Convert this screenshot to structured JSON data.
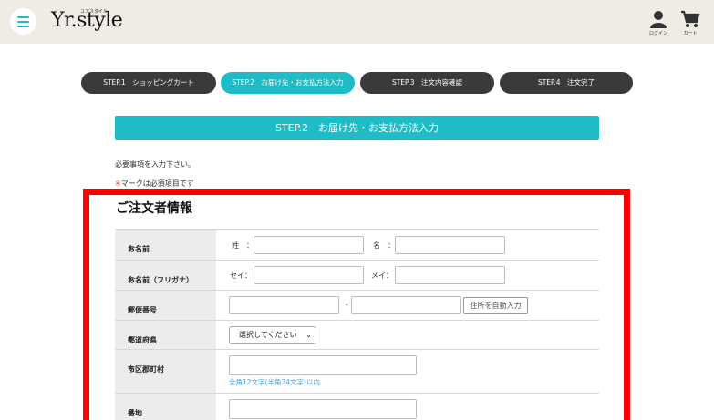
{
  "header": {
    "logo_sub": "ユアスタイル",
    "logo_text": "Yr.style",
    "login_label": "ログイン",
    "cart_label": "カート"
  },
  "steps": [
    {
      "label": "STEP.1　ショッピングカート",
      "active": false
    },
    {
      "label": "STEP.2　お届け先・お支払方法入力",
      "active": true
    },
    {
      "label": "STEP.3　注文内容確認",
      "active": false
    },
    {
      "label": "STEP.4　注文完了",
      "active": false
    }
  ],
  "page_title": "STEP.2　お届け先・お支払方法入力",
  "notes": {
    "required_entry": "必要事項を入力下さい。",
    "required_mark": "※",
    "required_mark_text": "マークは必須項目です"
  },
  "section_title": "ご注文者情報",
  "form": {
    "required_mark": "※",
    "name": {
      "label": "お名前",
      "last_label": "姓　：",
      "first_label": "名　：",
      "last_value": "",
      "first_value": ""
    },
    "kana": {
      "label": "お名前（フリガナ）",
      "last_label": "セイ：",
      "first_label": "メイ：",
      "last_value": "",
      "first_value": ""
    },
    "postal": {
      "label": "郵便番号",
      "separator": "-",
      "part1": "",
      "part2": "",
      "auto_button": "住所を自動入力"
    },
    "prefecture": {
      "label": "都道府県",
      "selected": "選択してください"
    },
    "city": {
      "label": "市区郡町村",
      "value": "",
      "hint": "全角12文字(半角24文字)以内"
    },
    "street": {
      "label": "番地",
      "value": ""
    }
  },
  "colors": {
    "accent": "#1fbcc7",
    "step_inactive": "#3a3a3a",
    "header_bg": "#efebe5",
    "highlight": "#ff0000",
    "required": "#e8433a",
    "hint": "#4aa3d8"
  }
}
